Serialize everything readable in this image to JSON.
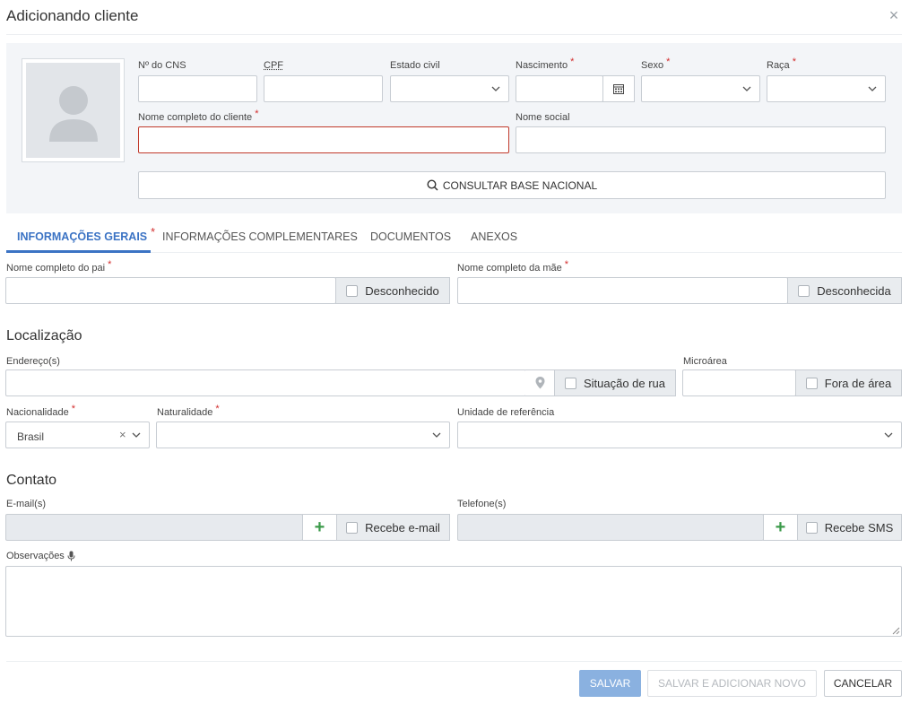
{
  "dialog": {
    "title": "Adicionando cliente",
    "close_label": "×"
  },
  "header": {
    "cns_label": "Nº do CNS",
    "cns_abbr": "CNS",
    "cpf_label": "CPF",
    "estado_civil_label": "Estado civil",
    "nascimento_label": "Nascimento",
    "sexo_label": "Sexo",
    "raca_label": "Raça",
    "nome_completo_label": "Nome completo do cliente",
    "nome_social_label": "Nome social",
    "consult_label": "CONSULTAR BASE NACIONAL",
    "required_mark": "*"
  },
  "tabs": [
    {
      "label": "INFORMAÇÕES GERAIS",
      "active": true,
      "required": true
    },
    {
      "label": "INFORMAÇÕES COMPLEMENTARES",
      "active": false
    },
    {
      "label": "DOCUMENTOS",
      "active": false
    },
    {
      "label": "ANEXOS",
      "active": false
    }
  ],
  "parents": {
    "pai_label": "Nome completo do pai",
    "pai_unknown": "Desconhecido",
    "mae_label": "Nome completo da mãe",
    "mae_unknown": "Desconhecida"
  },
  "localizacao": {
    "title": "Localização",
    "endereco_label": "Endereço(s)",
    "situacao_rua": "Situação de rua",
    "microarea_label": "Microárea",
    "fora_area": "Fora de área",
    "nacionalidade_label": "Nacionalidade",
    "nacionalidade_value": "Brasil",
    "naturalidade_label": "Naturalidade",
    "unidade_label": "Unidade de referência"
  },
  "contato": {
    "title": "Contato",
    "email_label": "E-mail(s)",
    "recebe_email": "Recebe e-mail",
    "telefone_label": "Telefone(s)",
    "recebe_sms": "Recebe SMS",
    "observacoes_label": "Observações",
    "plus": "+"
  },
  "footer": {
    "save": "SALVAR",
    "save_new": "SALVAR E ADICIONAR NOVO",
    "cancel": "CANCELAR"
  },
  "colors": {
    "accent": "#3b73c4",
    "required": "#d32f2f",
    "add": "#3b9a4a",
    "save_button": "#8ab1e0"
  }
}
